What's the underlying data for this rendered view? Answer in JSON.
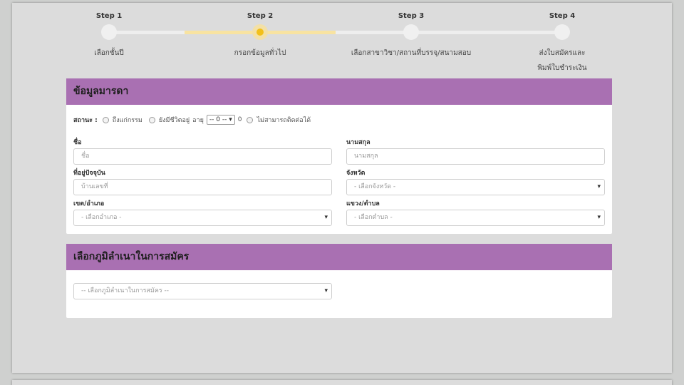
{
  "steps": [
    {
      "title": "Step 1",
      "desc": "เลือกชั้นปี"
    },
    {
      "title": "Step 2",
      "desc": "กรอกข้อมูลทั่วไป"
    },
    {
      "title": "Step 3",
      "desc": "เลือกสาขาวิชา/สถานที่บรรจุ/สนามสอบ"
    },
    {
      "title": "Step 4",
      "desc_line1": "ส่งใบสมัครและ",
      "desc_line2": "พิมพ์ใบชำระเงิน"
    }
  ],
  "current_step": 2,
  "colors": {
    "panel_header": "#a970b2",
    "active_step": "#f2c01a",
    "active_track": "#f8e3a1"
  },
  "mother_panel": {
    "title": "ข้อมูลมารดา",
    "status_label": "สถานะ :",
    "status_options": [
      "ถึงแก่กรรม",
      "ยังมีชีวิตอยู่",
      "ไม่สามารถติดต่อได้"
    ],
    "age_label": "อายุ",
    "age_value": "-- 0 --",
    "age_unit": "0",
    "first_name_label": "ชื่อ",
    "first_name_placeholder": "ชื่อ",
    "last_name_label": "นามสกุล",
    "last_name_placeholder": "นามสกุล",
    "address_label": "ที่อยู่ปัจจุบัน",
    "address_placeholder": "บ้านเลขที่",
    "province_label": "จังหวัด",
    "province_value": "- เลือกจังหวัด -",
    "district_label": "เขต/อำเภอ",
    "district_value": "- เลือกอำเภอ -",
    "subdistrict_label": "แขวง/ตำบล",
    "subdistrict_value": "- เลือกตำบล -"
  },
  "domicile_panel": {
    "title": "เลือกภูมิลำเนาในการสมัคร",
    "select_value": "-- เลือกภูมิลำเนาในการสมัคร --"
  }
}
